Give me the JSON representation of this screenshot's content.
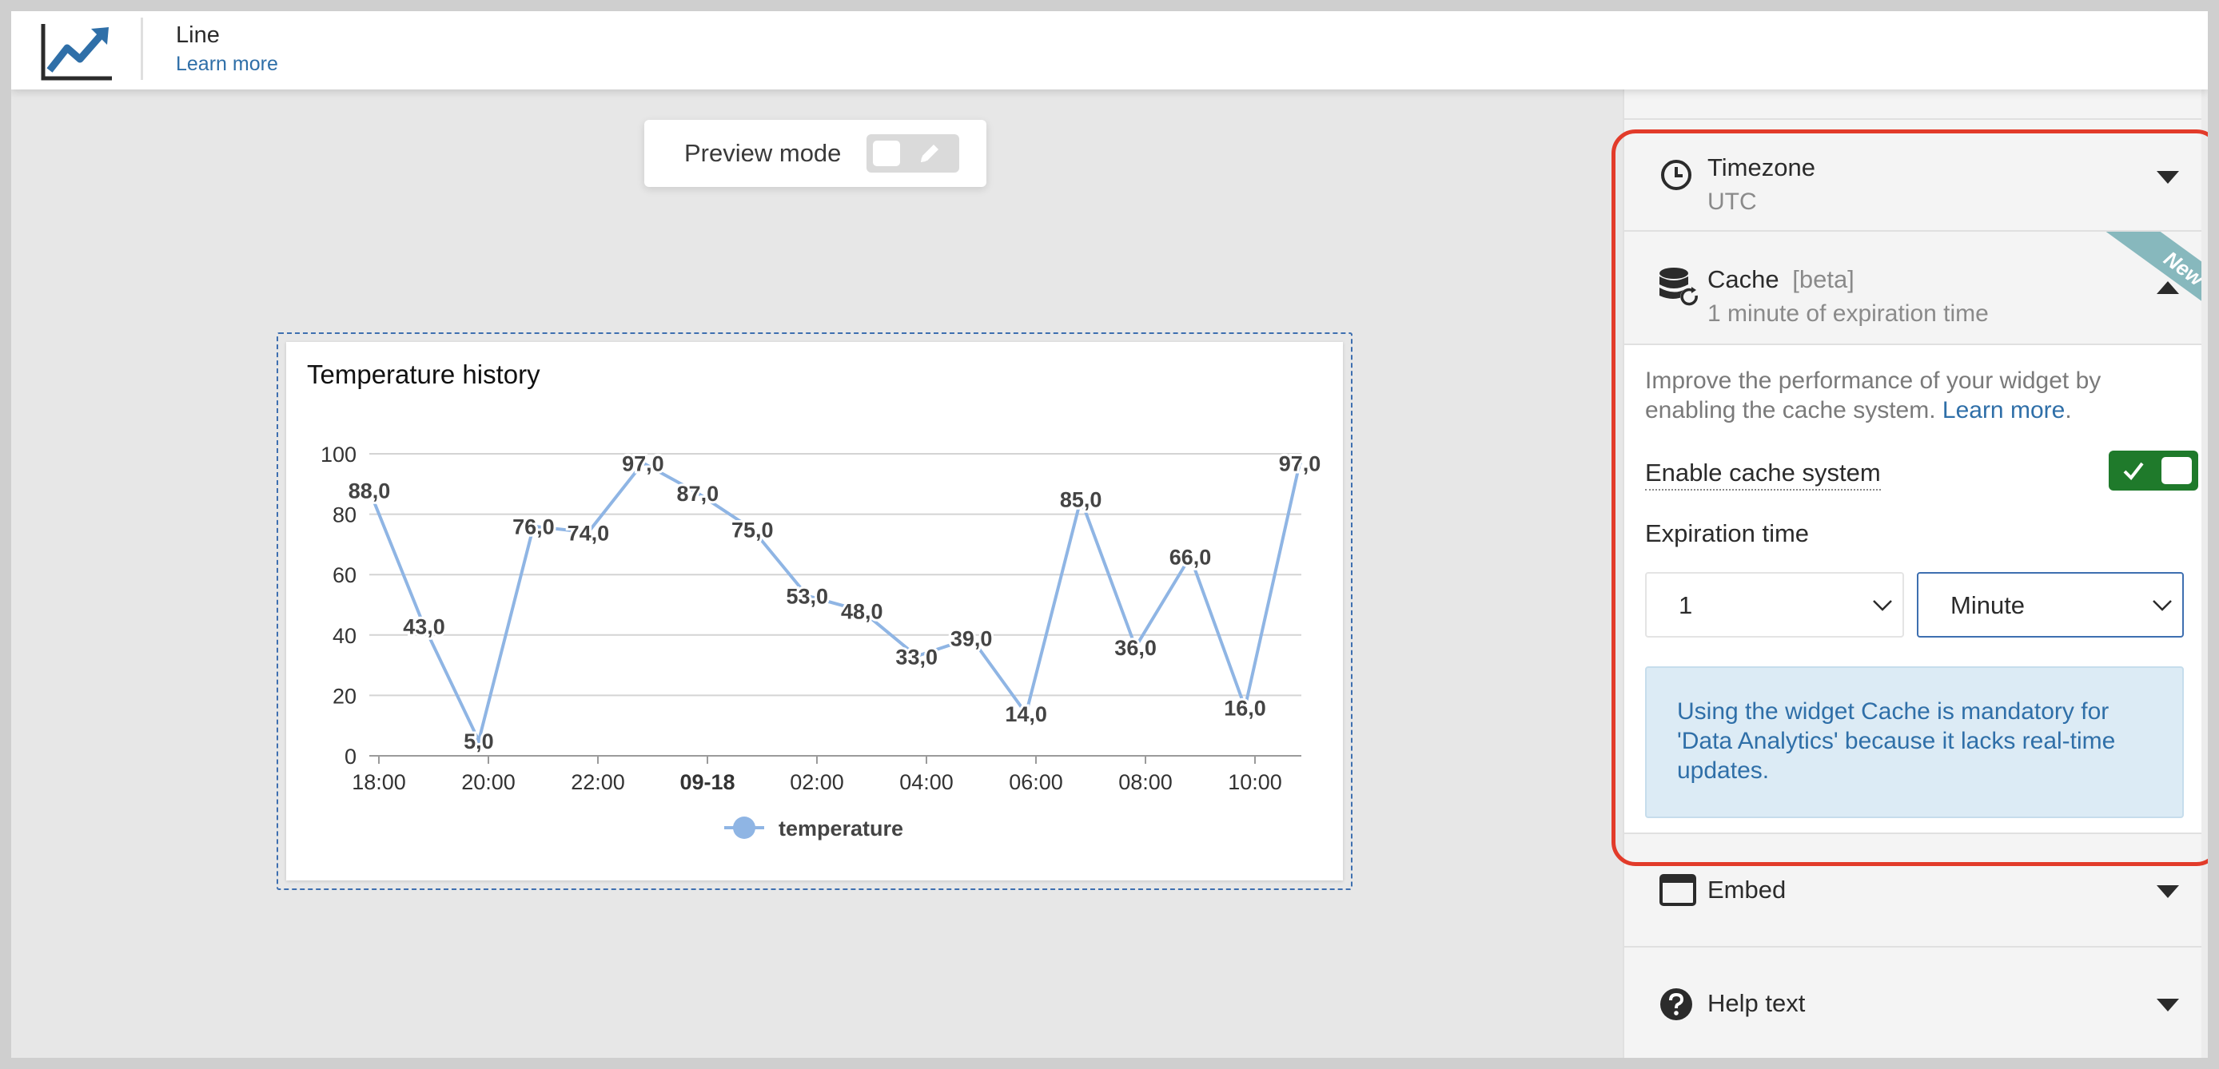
{
  "header": {
    "logo_icon": "line-chart-icon",
    "widget_name": "Line",
    "learn_more": "Learn more"
  },
  "preview": {
    "label": "Preview mode",
    "toggle_on": false,
    "toggle_icon": "pencil-icon"
  },
  "chart_data": {
    "type": "line",
    "title": "Temperature history",
    "x_tick_labels": [
      "18:00",
      "20:00",
      "22:00",
      "09-18",
      "02:00",
      "04:00",
      "06:00",
      "08:00",
      "10:00"
    ],
    "y_tick_labels": [
      "0",
      "20",
      "40",
      "60",
      "80",
      "100"
    ],
    "ylim": [
      0,
      100
    ],
    "grid": true,
    "legend_position": "bottom",
    "series": [
      {
        "name": "temperature",
        "color": "#8fb5e4",
        "values": [
          88,
          43,
          5,
          76,
          74,
          97,
          87,
          75,
          53,
          48,
          33,
          39,
          14,
          85,
          36,
          66,
          16,
          97
        ],
        "labels": [
          "88,0",
          "43,0",
          "5,0",
          "76,0",
          "74,0",
          "97,0",
          "87,0",
          "75,0",
          "53,0",
          "48,0",
          "33,0",
          "39,0",
          "14,0",
          "85,0",
          "36,0",
          "66,0",
          "16,0",
          "97,0"
        ]
      }
    ]
  },
  "sidebar": {
    "timezone": {
      "icon": "clock-icon",
      "title": "Timezone",
      "subtitle": "UTC",
      "expanded": false
    },
    "cache": {
      "icon": "database-refresh-icon",
      "title": "Cache",
      "tag": "[beta]",
      "subtitle": "1 minute of expiration time",
      "ribbon": "New",
      "expanded": true,
      "description": "Improve the performance of your widget by enabling the cache system.",
      "learn_more": "Learn more",
      "enable_label": "Enable cache system",
      "enabled": true,
      "expiration_label": "Expiration time",
      "expiration_value": "1",
      "expiration_unit": "Minute",
      "notice": "Using the widget Cache is mandatory for 'Data Analytics' because it lacks real-time updates."
    },
    "embed": {
      "icon": "window-icon",
      "title": "Embed",
      "expanded": false
    },
    "help": {
      "icon": "question-circle-icon",
      "title": "Help text",
      "expanded": false
    }
  },
  "colors": {
    "accent": "#2f6fa8",
    "toggle_on": "#1f7a2b",
    "highlight": "#e23b2a",
    "notice_bg": "#dcebf5",
    "ribbon": "#87b8bd"
  }
}
